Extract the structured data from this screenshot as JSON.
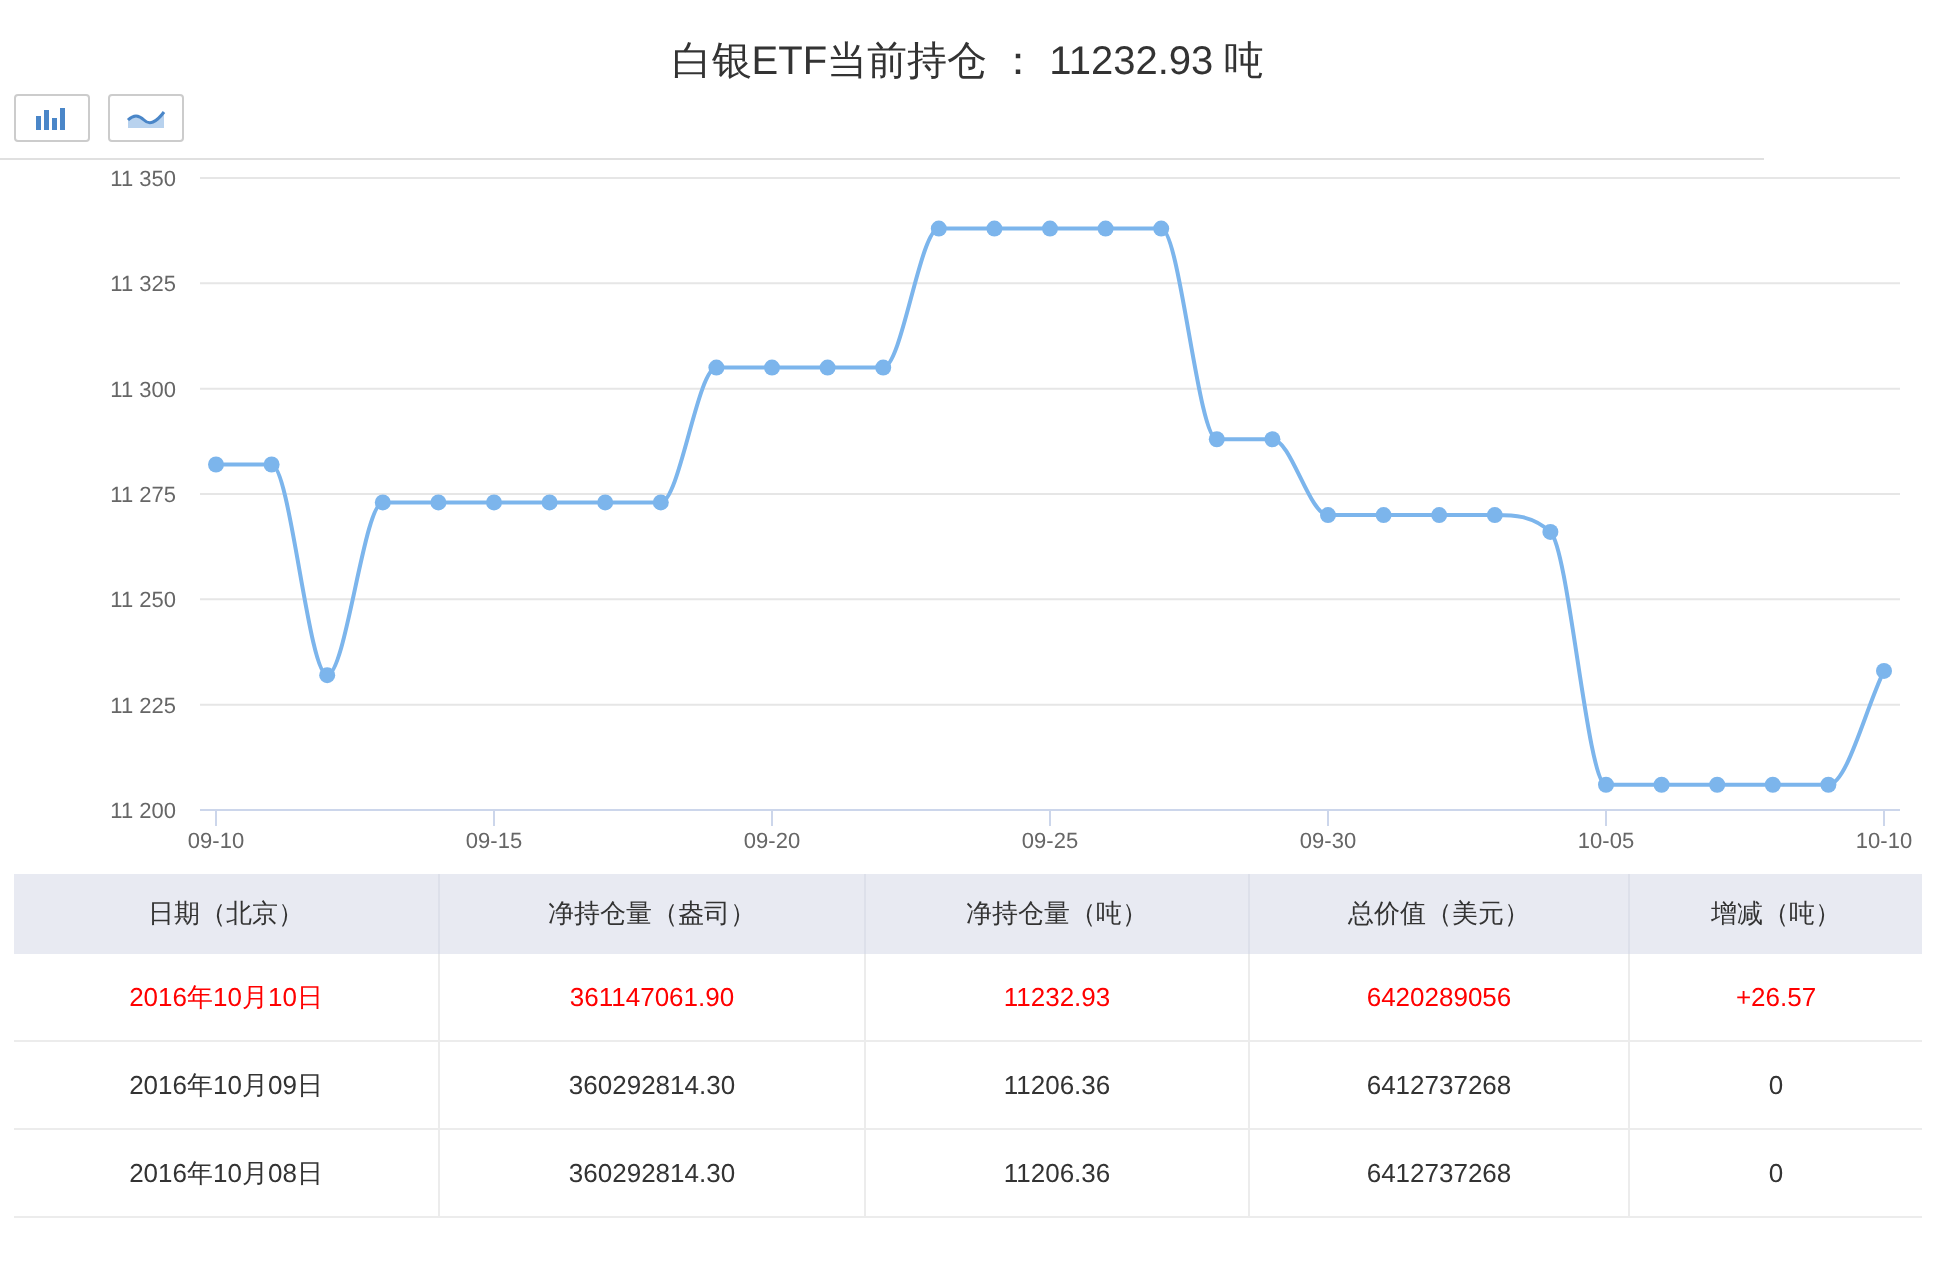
{
  "title": "白银ETF当前持仓 ： 11232.93 吨",
  "chart_type_buttons": [
    {
      "kind": "bar"
    },
    {
      "kind": "line"
    }
  ],
  "chart": {
    "chart_data": {
      "type": "line",
      "categories": [
        "09-10",
        null,
        null,
        null,
        null,
        "09-15",
        null,
        null,
        null,
        null,
        "09-20",
        null,
        null,
        null,
        null,
        "09-25",
        null,
        null,
        null,
        null,
        "09-30",
        null,
        null,
        null,
        null,
        "10-05",
        null,
        null,
        null,
        null,
        "10-10"
      ],
      "series": [
        {
          "color": "#7cb5ec",
          "marker": "circle",
          "values": [
            11282,
            11282,
            11232,
            11273,
            11273,
            11273,
            11273,
            11273,
            11273,
            11305,
            11305,
            11305,
            11305,
            11338,
            11338,
            11338,
            11338,
            11338,
            11288,
            11288,
            11270,
            11270,
            11270,
            11270,
            11266,
            11206,
            11206,
            11206,
            11206,
            11206,
            11233
          ]
        }
      ],
      "grid": true,
      "ylim": [
        11200,
        11350
      ],
      "yticks": [
        {
          "value": 11200,
          "label": "11 200"
        },
        {
          "value": 11225,
          "label": "11 225"
        },
        {
          "value": 11250,
          "label": "11 250"
        },
        {
          "value": 11275,
          "label": "11 275"
        },
        {
          "value": 11300,
          "label": "11 300"
        },
        {
          "value": 11325,
          "label": "11 325"
        },
        {
          "value": 11350,
          "label": "11 350"
        }
      ]
    }
  },
  "table": {
    "columns": [
      "日期（北京）",
      "净持仓量（盎司）",
      "净持仓量（吨）",
      "总价值（美元）",
      "增减（吨）"
    ],
    "rows": [
      {
        "highlighted": true,
        "cells": [
          "2016年10月10日",
          "361147061.90",
          "11232.93",
          "6420289056",
          "+26.57"
        ]
      },
      {
        "highlighted": false,
        "cells": [
          "2016年10月09日",
          "360292814.30",
          "11206.36",
          "6412737268",
          "0"
        ]
      },
      {
        "highlighted": false,
        "cells": [
          "2016年10月08日",
          "360292814.30",
          "11206.36",
          "6412737268",
          "0"
        ]
      }
    ]
  }
}
